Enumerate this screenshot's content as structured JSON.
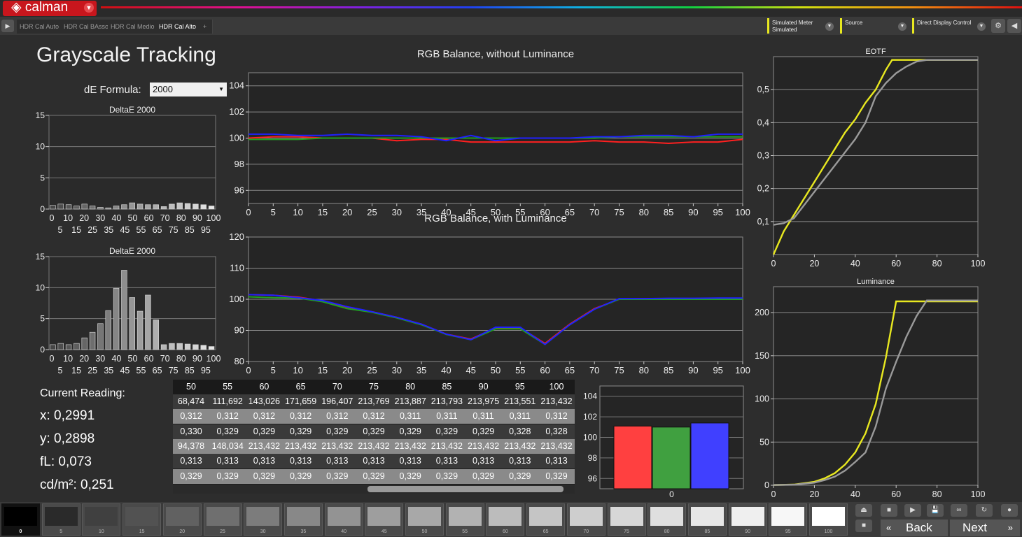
{
  "app": {
    "logo": "calman"
  },
  "tabs": [
    {
      "label": "HDR Cal  Auto"
    },
    {
      "label": "HDR Cal BAsso"
    },
    {
      "label": "HDR Cal Medio"
    },
    {
      "label": "HDR Cal Alto",
      "active": true
    }
  ],
  "header": {
    "meter": {
      "line1": "Simulated Meter",
      "line2": "Simulated"
    },
    "source": "Source",
    "display": "Direct Display Control"
  },
  "page": {
    "title": "Grayscale Tracking",
    "de_formula_label": "dE Formula:",
    "de_formula_value": "2000"
  },
  "current_reading": {
    "label": "Current Reading:",
    "x": "x: 0,2991",
    "y": "y: 0,2898",
    "fl": "fL: 0,073",
    "cdm2": "cd/m²: 0,251"
  },
  "table": {
    "columns": [
      "50",
      "55",
      "60",
      "65",
      "70",
      "75",
      "80",
      "85",
      "90",
      "95",
      "100"
    ],
    "rows": [
      [
        "68,474",
        "111,692",
        "143,026",
        "171,659",
        "196,407",
        "213,769",
        "213,887",
        "213,793",
        "213,975",
        "213,551",
        "213,432"
      ],
      [
        "0,312",
        "0,312",
        "0,312",
        "0,312",
        "0,312",
        "0,312",
        "0,311",
        "0,311",
        "0,311",
        "0,311",
        "0,312"
      ],
      [
        "0,330",
        "0,329",
        "0,329",
        "0,329",
        "0,329",
        "0,329",
        "0,329",
        "0,329",
        "0,329",
        "0,328",
        "0,328"
      ],
      [
        "94,378",
        "148,034",
        "213,432",
        "213,432",
        "213,432",
        "213,432",
        "213,432",
        "213,432",
        "213,432",
        "213,432",
        "213,432"
      ],
      [
        "0,313",
        "0,313",
        "0,313",
        "0,313",
        "0,313",
        "0,313",
        "0,313",
        "0,313",
        "0,313",
        "0,313",
        "0,313"
      ],
      [
        "0,329",
        "0,329",
        "0,329",
        "0,329",
        "0,329",
        "0,329",
        "0,329",
        "0,329",
        "0,329",
        "0,329",
        "0,329"
      ]
    ]
  },
  "swatches": [
    "0",
    "5",
    "10",
    "15",
    "20",
    "25",
    "30",
    "35",
    "40",
    "45",
    "50",
    "55",
    "60",
    "65",
    "70",
    "75",
    "80",
    "85",
    "90",
    "95",
    "100"
  ],
  "nav": {
    "back": "Back",
    "next": "Next"
  },
  "chart_data": [
    {
      "id": "de1",
      "type": "bar",
      "title": "DeltaE 2000",
      "ylim": [
        0,
        15
      ],
      "yticks": [
        0,
        5,
        10,
        15
      ],
      "categories": [
        0,
        5,
        10,
        15,
        20,
        25,
        30,
        35,
        40,
        45,
        50,
        55,
        60,
        65,
        70,
        75,
        80,
        85,
        90,
        95,
        100
      ],
      "values": [
        0.6,
        0.8,
        0.7,
        0.5,
        0.8,
        0.5,
        0.3,
        0.2,
        0.5,
        0.7,
        1.0,
        0.8,
        0.7,
        0.7,
        0.4,
        0.8,
        1.0,
        0.9,
        0.8,
        0.7,
        0.5
      ],
      "xticks_top": [
        "0",
        "10",
        "20",
        "30",
        "40",
        "50",
        "60",
        "70",
        "80",
        "90",
        "100"
      ],
      "xticks_bottom": [
        "5",
        "15",
        "25",
        "35",
        "45",
        "55",
        "65",
        "75",
        "85",
        "95"
      ]
    },
    {
      "id": "de2",
      "type": "bar",
      "title": "DeltaE 2000",
      "ylim": [
        0,
        15
      ],
      "yticks": [
        0,
        5,
        10,
        15
      ],
      "categories": [
        0,
        5,
        10,
        15,
        20,
        25,
        30,
        35,
        40,
        45,
        50,
        55,
        60,
        65,
        70,
        75,
        80,
        85,
        90,
        95,
        100
      ],
      "values": [
        0.8,
        1.0,
        0.8,
        1.0,
        1.9,
        2.8,
        4.2,
        6.3,
        9.9,
        12.8,
        8.4,
        6.2,
        8.8,
        4.8,
        0.8,
        1.0,
        1.0,
        0.9,
        0.8,
        0.7,
        0.5
      ],
      "xticks_top": [
        "0",
        "10",
        "20",
        "30",
        "40",
        "50",
        "60",
        "70",
        "80",
        "90",
        "100"
      ],
      "xticks_bottom": [
        "5",
        "15",
        "25",
        "35",
        "45",
        "55",
        "65",
        "75",
        "85",
        "95"
      ]
    },
    {
      "id": "rgb1",
      "type": "line",
      "title": "RGB Balance, without Luminance",
      "ylim": [
        95,
        105
      ],
      "yticks": [
        96,
        98,
        100,
        102,
        104
      ],
      "xticks": [
        0,
        5,
        10,
        15,
        20,
        25,
        30,
        35,
        40,
        45,
        50,
        55,
        60,
        65,
        70,
        75,
        80,
        85,
        90,
        95,
        100
      ],
      "x": [
        0,
        5,
        10,
        15,
        20,
        25,
        30,
        35,
        40,
        45,
        50,
        55,
        60,
        65,
        70,
        75,
        80,
        85,
        90,
        95,
        100
      ],
      "series": [
        {
          "color": "#ff2020",
          "values": [
            100.0,
            100.1,
            100.1,
            100.0,
            100.0,
            100.0,
            99.8,
            99.9,
            99.9,
            99.7,
            99.7,
            99.7,
            99.7,
            99.7,
            99.8,
            99.7,
            99.7,
            99.6,
            99.7,
            99.7,
            99.9
          ]
        },
        {
          "color": "#20a020",
          "values": [
            99.9,
            99.9,
            99.9,
            100.0,
            100.0,
            100.0,
            100.0,
            100.0,
            100.0,
            100.0,
            100.0,
            100.0,
            100.0,
            100.0,
            100.0,
            100.1,
            100.1,
            100.1,
            100.1,
            100.1,
            100.1
          ]
        },
        {
          "color": "#2020ff",
          "values": [
            100.3,
            100.3,
            100.2,
            100.2,
            100.3,
            100.2,
            100.2,
            100.1,
            99.8,
            100.2,
            99.8,
            100.0,
            100.0,
            100.0,
            100.1,
            100.1,
            100.2,
            100.2,
            100.1,
            100.3,
            100.3
          ]
        }
      ]
    },
    {
      "id": "rgb2",
      "type": "line",
      "title": "RGB Balance, with Luminance",
      "ylim": [
        80,
        120
      ],
      "yticks": [
        80,
        90,
        100,
        110,
        120
      ],
      "xticks": [
        0,
        5,
        10,
        15,
        20,
        25,
        30,
        35,
        40,
        45,
        50,
        55,
        60,
        65,
        70,
        75,
        80,
        85,
        90,
        95,
        100
      ],
      "x": [
        0,
        5,
        10,
        15,
        20,
        25,
        30,
        35,
        40,
        45,
        50,
        55,
        60,
        65,
        70,
        75,
        80,
        85,
        90,
        95,
        100
      ],
      "series": [
        {
          "color": "#ff2020",
          "values": [
            101.5,
            101.3,
            100.7,
            99.5,
            97.5,
            96.0,
            94.2,
            92.0,
            88.8,
            87.2,
            90.8,
            90.8,
            85.8,
            92.0,
            97.0,
            100.0,
            100.2,
            100.2,
            100.2,
            100.3,
            100.3
          ]
        },
        {
          "color": "#20a020",
          "values": [
            100.8,
            100.5,
            100.4,
            99.2,
            97.0,
            95.8,
            94.0,
            91.8,
            88.7,
            87.0,
            90.5,
            90.5,
            85.5,
            91.8,
            96.8,
            100.0,
            100.0,
            100.0,
            100.0,
            100.0,
            100.0
          ]
        },
        {
          "color": "#2020ff",
          "values": [
            101.5,
            101.3,
            100.5,
            99.6,
            97.6,
            96.0,
            94.2,
            92.0,
            88.8,
            87.0,
            91.0,
            91.0,
            85.5,
            91.8,
            96.8,
            100.2,
            100.2,
            100.3,
            100.3,
            100.4,
            100.4
          ]
        }
      ]
    },
    {
      "id": "rgbbars",
      "type": "bar",
      "ylim": [
        95,
        105
      ],
      "yticks": [
        96,
        98,
        100,
        102,
        104
      ],
      "categories": [
        "0"
      ],
      "series": [
        {
          "color": "#ff4040",
          "values": [
            101.1
          ]
        },
        {
          "color": "#40a040",
          "values": [
            101.0
          ]
        },
        {
          "color": "#4040ff",
          "values": [
            101.4
          ]
        }
      ]
    },
    {
      "id": "eotf",
      "type": "line",
      "title": "EOTF",
      "ylim": [
        0,
        0.6
      ],
      "xlim": [
        0,
        100
      ],
      "yticks": [
        "0,1",
        "0,2",
        "0,3",
        "0,4",
        "0,5"
      ],
      "ytick_values": [
        0.1,
        0.2,
        0.3,
        0.4,
        0.5
      ],
      "xticks": [
        0,
        20,
        40,
        60,
        80,
        100
      ],
      "series": [
        {
          "color": "#e8e820",
          "x": [
            0,
            5,
            10,
            15,
            20,
            25,
            30,
            35,
            40,
            45,
            50,
            55,
            58,
            60,
            100
          ],
          "values": [
            0,
            0.07,
            0.12,
            0.17,
            0.22,
            0.27,
            0.32,
            0.37,
            0.41,
            0.46,
            0.5,
            0.56,
            0.59,
            0.59,
            0.59
          ]
        },
        {
          "color": "#9a9a9a",
          "x": [
            0,
            5,
            10,
            15,
            20,
            25,
            30,
            35,
            40,
            45,
            50,
            55,
            60,
            65,
            70,
            75,
            100
          ],
          "values": [
            0.09,
            0.095,
            0.11,
            0.15,
            0.19,
            0.23,
            0.27,
            0.31,
            0.35,
            0.4,
            0.48,
            0.52,
            0.55,
            0.57,
            0.585,
            0.59,
            0.59
          ]
        }
      ]
    },
    {
      "id": "lum",
      "type": "line",
      "title": "Luminance",
      "ylim": [
        0,
        230
      ],
      "xlim": [
        0,
        100
      ],
      "yticks": [
        "0",
        "50",
        "100",
        "150",
        "200"
      ],
      "ytick_values": [
        0,
        50,
        100,
        150,
        200
      ],
      "xticks": [
        0,
        20,
        40,
        60,
        80,
        100
      ],
      "series": [
        {
          "color": "#e8e820",
          "x": [
            0,
            10,
            20,
            25,
            30,
            35,
            40,
            45,
            50,
            55,
            60,
            75,
            100
          ],
          "values": [
            0.3,
            0.8,
            4,
            8,
            14,
            24,
            38,
            60,
            94,
            148,
            213,
            213,
            213
          ]
        },
        {
          "color": "#9a9a9a",
          "x": [
            0,
            10,
            20,
            25,
            30,
            35,
            40,
            45,
            50,
            55,
            60,
            65,
            70,
            75,
            100
          ],
          "values": [
            0.3,
            0.6,
            3,
            6,
            10,
            17,
            27,
            38,
            68,
            112,
            143,
            172,
            196,
            214,
            214
          ]
        }
      ]
    }
  ]
}
